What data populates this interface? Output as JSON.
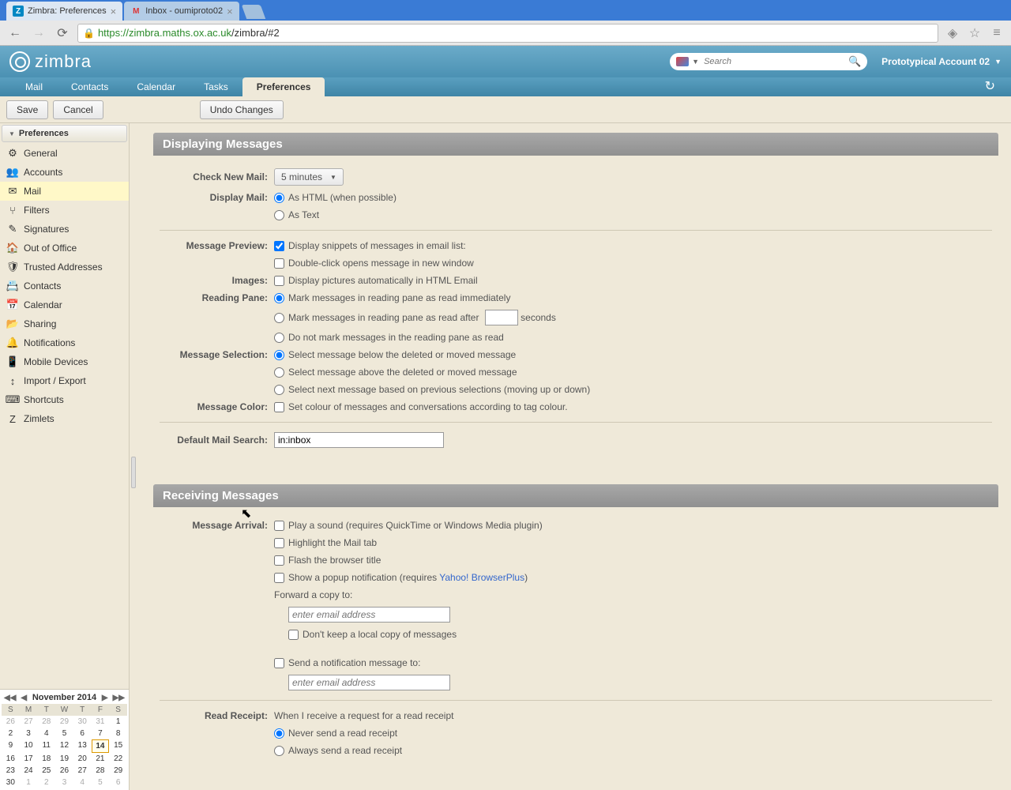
{
  "browser": {
    "tab1_title": "Zimbra: Preferences",
    "tab2_title": "Inbox - oumiproto02",
    "url_host": "https://zimbra.maths.ox.ac.uk",
    "url_path": "/zimbra/#2"
  },
  "header": {
    "logo": "zimbra",
    "search_placeholder": "Search",
    "account": "Prototypical Account 02"
  },
  "apptabs": {
    "mail": "Mail",
    "contacts": "Contacts",
    "calendar": "Calendar",
    "tasks": "Tasks",
    "preferences": "Preferences"
  },
  "toolbar": {
    "save": "Save",
    "cancel": "Cancel",
    "undo": "Undo Changes"
  },
  "sidebar": {
    "header": "Preferences",
    "items": [
      {
        "label": "General",
        "icon": "⚙"
      },
      {
        "label": "Accounts",
        "icon": "👥"
      },
      {
        "label": "Mail",
        "icon": "✉"
      },
      {
        "label": "Filters",
        "icon": "⑂"
      },
      {
        "label": "Signatures",
        "icon": "✎"
      },
      {
        "label": "Out of Office",
        "icon": "🏠"
      },
      {
        "label": "Trusted Addresses",
        "icon": "🛡"
      },
      {
        "label": "Contacts",
        "icon": "📇"
      },
      {
        "label": "Calendar",
        "icon": "📅"
      },
      {
        "label": "Sharing",
        "icon": "📂"
      },
      {
        "label": "Notifications",
        "icon": "🔔"
      },
      {
        "label": "Mobile Devices",
        "icon": "📱"
      },
      {
        "label": "Import / Export",
        "icon": "↕"
      },
      {
        "label": "Shortcuts",
        "icon": "⌨"
      },
      {
        "label": "Zimlets",
        "icon": "Z"
      }
    ]
  },
  "calendar": {
    "title": "November 2014",
    "dows": [
      "S",
      "M",
      "T",
      "W",
      "T",
      "F",
      "S"
    ],
    "prev": [
      "26",
      "27",
      "28",
      "29",
      "30",
      "31"
    ],
    "days_row1": [
      "1"
    ],
    "days_row2": [
      "2",
      "3",
      "4",
      "5",
      "6",
      "7",
      "8"
    ],
    "days_row3": [
      "9",
      "10",
      "11",
      "12",
      "13",
      "14",
      "15"
    ],
    "days_row4": [
      "16",
      "17",
      "18",
      "19",
      "20",
      "21",
      "22"
    ],
    "days_row5": [
      "23",
      "24",
      "25",
      "26",
      "27",
      "28",
      "29"
    ],
    "days_row6": [
      "30"
    ],
    "next": [
      "1",
      "2",
      "3",
      "4",
      "5",
      "6"
    ],
    "today": "14"
  },
  "section1": {
    "title": "Displaying Messages",
    "check_new_mail_label": "Check New Mail:",
    "check_interval": "5 minutes",
    "display_mail_label": "Display Mail:",
    "as_html": "As HTML (when possible)",
    "as_text": "As Text",
    "msg_preview_label": "Message Preview:",
    "snippets": "Display snippets of messages in email list:",
    "dblclick": "Double-click opens message in new window",
    "images_label": "Images:",
    "images_opt": "Display pictures automatically in HTML Email",
    "reading_pane_label": "Reading Pane:",
    "rp1": "Mark messages in reading pane as read immediately",
    "rp2a": "Mark messages in reading pane as read after",
    "rp2b": "seconds",
    "rp3": "Do not mark messages in the reading pane as read",
    "msg_sel_label": "Message Selection:",
    "ms1": "Select message below the deleted or moved message",
    "ms2": "Select message above the deleted or moved message",
    "ms3": "Select next message based on previous selections (moving up or down)",
    "msg_color_label": "Message Color:",
    "msg_color_opt": "Set colour of messages and conversations according to tag colour.",
    "default_search_label": "Default Mail Search:",
    "default_search_value": "in:inbox"
  },
  "section2": {
    "title": "Receiving Messages",
    "arrival_label": "Message Arrival:",
    "arr1": "Play a sound (requires QuickTime or Windows Media plugin)",
    "arr2": "Highlight the Mail tab",
    "arr3": "Flash the browser title",
    "arr4a": "Show a popup notification (requires ",
    "arr4b": "Yahoo! BrowserPlus",
    "arr4c": ")",
    "fwd_label": "Forward a copy to:",
    "fwd_placeholder": "enter email address",
    "keep_copy": "Don't keep a local copy of messages",
    "notify_label": "Send a notification message to:",
    "notify_placeholder": "enter email address",
    "receipt_label": "Read Receipt:",
    "receipt_text": "When I receive a request for a read receipt",
    "rr1": "Never send a read receipt",
    "rr2": "Always send a read receipt"
  }
}
